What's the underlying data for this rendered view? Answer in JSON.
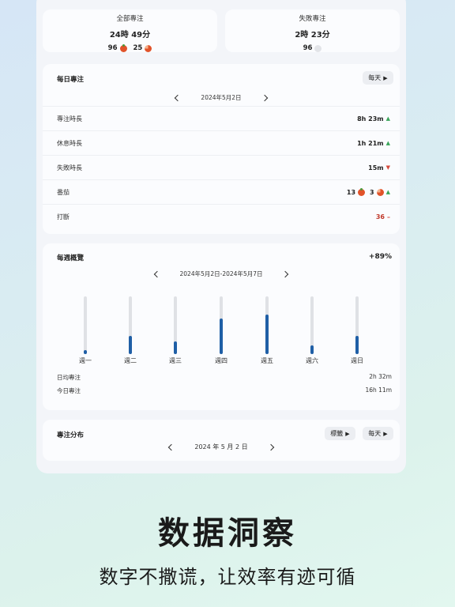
{
  "summary": {
    "all": {
      "title": "全部專注",
      "value": "24時 49分",
      "count_full": "96",
      "count_partial": "25"
    },
    "failed": {
      "title": "失敗專注",
      "value": "2時 23分",
      "count": "96"
    }
  },
  "daily": {
    "title": "每日專注",
    "period_button": "每天",
    "date": "2024年5月2日",
    "rows": [
      {
        "label": "專注時長",
        "value": "8h 23m",
        "trend": "▲"
      },
      {
        "label": "休息時長",
        "value": "1h 21m",
        "trend": "▲"
      },
      {
        "label": "失敗時長",
        "value": "15m",
        "trend": "▼"
      },
      {
        "label": "番茄",
        "value_full": "13",
        "value_partial": "3",
        "trend": "▲"
      },
      {
        "label": "打斷",
        "value": "36",
        "trend": "–"
      }
    ]
  },
  "weekly": {
    "title": "每週概覽",
    "change": "+89%",
    "date_range": "2024年5月2日-2024年5月7日",
    "days": [
      {
        "label": "週一",
        "fraction": 0.07
      },
      {
        "label": "週二",
        "fraction": 0.31
      },
      {
        "label": "週三",
        "fraction": 0.22
      },
      {
        "label": "週四",
        "fraction": 0.62
      },
      {
        "label": "週五",
        "fraction": 0.69
      },
      {
        "label": "週六",
        "fraction": 0.15
      },
      {
        "label": "週日",
        "fraction": 0.31
      }
    ],
    "avg_label": "日均專注",
    "avg_value": "2h 32m",
    "today_label": "今日專注",
    "today_value": "16h 11m"
  },
  "distribution": {
    "title": "專注分布",
    "tag_button": "標籤",
    "period_button": "每天",
    "date": "2024 年 5 月 2 日"
  },
  "promo": {
    "headline": "数据洞察",
    "subline": "数字不撒谎，让效率有迹可循"
  },
  "colors": {
    "accent": "#1f5fa6",
    "up": "#3aa55a",
    "down": "#d64a3c",
    "tomato": "#e1532a"
  }
}
